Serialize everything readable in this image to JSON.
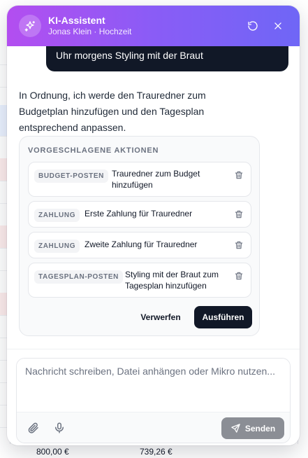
{
  "header": {
    "title": "KI-Assistent",
    "subtitle": "Jonas Klein · Hochzeit",
    "accent_from": "#b34ef0",
    "accent_to": "#6f66f6"
  },
  "messages": {
    "user_last_line": "Uhr morgens Styling mit der Braut",
    "assistant_text": "In Ordnung, ich werde den Trauredner zum Budgetplan hinzufügen und den Tagesplan entsprechend anpassen."
  },
  "actions": {
    "title": "VORGESCHLAGENE AKTIONEN",
    "items": [
      {
        "tag": "BUDGET-POSTEN",
        "text": "Trauredner zum Budget hinzufügen"
      },
      {
        "tag": "ZAHLUNG",
        "text": "Erste Zahlung für Trauredner"
      },
      {
        "tag": "ZAHLUNG",
        "text": "Zweite Zahlung für Trauredner"
      },
      {
        "tag": "TAGESPLAN-POSTEN",
        "text": "Styling mit der Braut zum Tagesplan hinzufügen"
      }
    ],
    "discard_label": "Verwerfen",
    "execute_label": "Ausführen"
  },
  "composer": {
    "placeholder": "Nachricht schreiben, Datei anhängen oder Mikro nutzen...",
    "value": "",
    "send_label": "Senden"
  },
  "background": {
    "amount_left": "800,00 €",
    "amount_right": "739,26 €"
  },
  "icons": {
    "assistant": "sparkle-icon",
    "reset": "refresh-icon",
    "close": "close-icon",
    "delete": "trash-icon",
    "attach": "paperclip-icon",
    "mic": "microphone-icon",
    "send": "send-icon"
  }
}
